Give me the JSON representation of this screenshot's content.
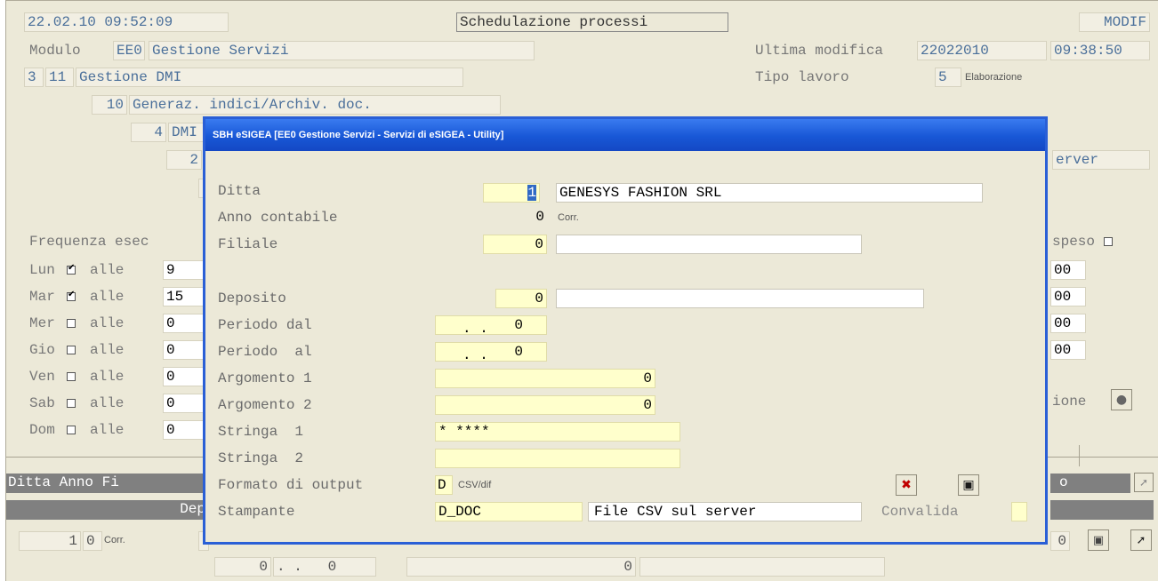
{
  "main": {
    "datetime": "22.02.10 09:52:09",
    "title": "Schedulazione processi",
    "mode": "MODIF",
    "modulo_label": "Modulo",
    "modulo_code": "EE0",
    "modulo_name": "Gestione Servizi",
    "ultima_modifica_label": "Ultima modifica",
    "ultima_modifica_date": "22022010",
    "ultima_modifica_time": "09:38:50",
    "tipo_lavoro_label": "Tipo lavoro",
    "tipo_lavoro_code": "5",
    "tipo_lavoro_desc": "Elaborazione",
    "level1_a": "3",
    "level1_b": "11",
    "level1_name": "Gestione DMI",
    "level2_num": "10",
    "level2_name": "Generaz. indici/Archiv. doc.",
    "level3_num": "4",
    "level3_name": "DMI",
    "level4_num": "2",
    "server_tail": "erver",
    "frequenza_label": "Frequenza esec",
    "sospeso_label": "speso",
    "days": [
      {
        "day": "Lun",
        "checked": true,
        "alle": "alle",
        "time": "9",
        "right": "00"
      },
      {
        "day": "Mar",
        "checked": true,
        "alle": "alle",
        "time": "15",
        "right": "00"
      },
      {
        "day": "Mer",
        "checked": false,
        "alle": "alle",
        "time": "0",
        "right": "00"
      },
      {
        "day": "Gio",
        "checked": false,
        "alle": "alle",
        "time": "0",
        "right": "00"
      },
      {
        "day": "Ven",
        "checked": false,
        "alle": "alle",
        "time": "0",
        "right": ""
      },
      {
        "day": "Sab",
        "checked": false,
        "alle": "alle",
        "time": "0",
        "right": ""
      },
      {
        "day": "Dom",
        "checked": false,
        "alle": "alle",
        "time": "0",
        "right": ""
      }
    ],
    "ione_label": "ione",
    "grid_header": "Ditta Anno  Fi",
    "grid_header2": "Dep",
    "grid_header_right": "o",
    "row_ditta": "1",
    "row_anno": "0",
    "row_corr": "Corr.",
    "row_right": "0",
    "bottom_1": "0",
    "bottom_2": ". .   0",
    "bottom_3": "0"
  },
  "dialog": {
    "title": "SBH eSIGEA [EE0 Gestione Servizi - Servizi di eSIGEA - Utility]",
    "ditta_label": "Ditta",
    "ditta_code": "1",
    "ditta_name": "GENESYS FASHION SRL",
    "anno_label": "Anno contabile",
    "anno_value": "0",
    "anno_corr": "Corr.",
    "filiale_label": "Filiale",
    "filiale_value": "0",
    "deposito_label": "Deposito",
    "deposito_value": "0",
    "periodo_dal_label": "Periodo dal",
    "periodo_dal_date": ". .",
    "periodo_dal_value": "0",
    "periodo_al_label": "Periodo  al",
    "periodo_al_date": ". .",
    "periodo_al_value": "0",
    "arg1_label": "Argomento 1",
    "arg1_value": "0",
    "arg2_label": "Argomento 2",
    "arg2_value": "0",
    "str1_label": "Stringa  1",
    "str1_value": "* ****",
    "str2_label": "Stringa  2",
    "str2_value": "",
    "formato_label": "Formato di output",
    "formato_code": "D",
    "formato_desc": "CSV/dif",
    "stampante_label": "Stampante",
    "stampante_value": "D_DOC",
    "stampante_desc": "File CSV sul server",
    "convalida_label": "Convalida"
  }
}
